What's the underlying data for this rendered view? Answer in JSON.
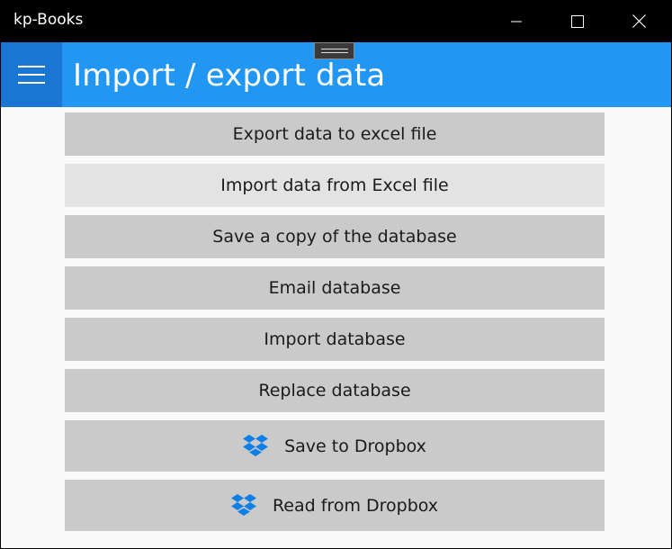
{
  "window": {
    "title": "kp-Books",
    "controls": {
      "minimize": "minimize-icon",
      "maximize": "maximize-icon",
      "close": "close-icon"
    }
  },
  "header": {
    "menu_icon": "hamburger-icon",
    "title": "Import / export data",
    "accent_color": "#2196f3",
    "menu_bg_color": "#1976d2"
  },
  "actions": [
    {
      "label": "Export data to excel file"
    },
    {
      "label": "Import data from Excel file",
      "state": "hover"
    },
    {
      "label": "Save a copy of the database"
    },
    {
      "label": "Email database"
    },
    {
      "label": "Import database"
    },
    {
      "label": "Replace database"
    },
    {
      "label": "Save to Dropbox",
      "icon": "dropbox-icon"
    },
    {
      "label": "Read from Dropbox",
      "icon": "dropbox-icon"
    }
  ],
  "colors": {
    "button_bg": "#cacaca",
    "button_hover_bg": "#e3e3e3",
    "dropbox_blue": "#0d7fe6"
  }
}
